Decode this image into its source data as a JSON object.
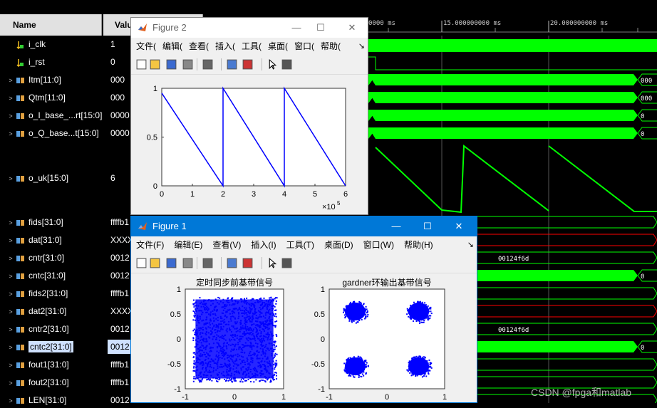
{
  "columns": {
    "name": "Name",
    "value": "Value"
  },
  "signals": [
    {
      "name": "i_clk",
      "value": "1",
      "expand": false,
      "icon": "clock-signal-icon"
    },
    {
      "name": "i_rst",
      "value": "0",
      "expand": false,
      "icon": "reset-signal-icon"
    },
    {
      "name": "Itm[11:0]",
      "value": "000",
      "expand": true,
      "icon": "bus-icon"
    },
    {
      "name": "Qtm[11:0]",
      "value": "000",
      "expand": true,
      "icon": "bus-icon"
    },
    {
      "name": "o_I_base_...rt[15:0]",
      "value": "0000",
      "expand": true,
      "icon": "bus-icon"
    },
    {
      "name": "o_Q_base...t[15:0]",
      "value": "0000",
      "expand": true,
      "icon": "bus-icon"
    },
    {
      "name": "o_uk[15:0]",
      "value": "6",
      "expand": true,
      "icon": "bus-icon"
    },
    {
      "name": "fids[31:0]",
      "value": "ffffb1",
      "expand": true,
      "icon": "bus-icon"
    },
    {
      "name": "dat[31:0]",
      "value": "XXXX",
      "expand": true,
      "icon": "bus-icon"
    },
    {
      "name": "cntr[31:0]",
      "value": "0012",
      "expand": true,
      "icon": "bus-icon"
    },
    {
      "name": "cntc[31:0]",
      "value": "0012",
      "expand": true,
      "icon": "bus-icon"
    },
    {
      "name": "fids2[31:0]",
      "value": "ffffb1",
      "expand": true,
      "icon": "bus-icon"
    },
    {
      "name": "dat2[31:0]",
      "value": "XXXX",
      "expand": true,
      "icon": "bus-icon"
    },
    {
      "name": "cntr2[31:0]",
      "value": "0012",
      "expand": true,
      "icon": "bus-icon"
    },
    {
      "name": "cntc2[31:0]",
      "value": "0012",
      "expand": true,
      "icon": "bus-icon",
      "selected": true
    },
    {
      "name": "fout1[31:0]",
      "value": "ffffb1",
      "expand": true,
      "icon": "bus-icon"
    },
    {
      "name": "fout2[31:0]",
      "value": "ffffb1",
      "expand": true,
      "icon": "bus-icon"
    },
    {
      "name": "LEN[31:0]",
      "value": "0012",
      "expand": true,
      "icon": "bus-icon"
    }
  ],
  "ruler": {
    "labels": [
      "0000 ms",
      "15.000000000 ms",
      "20.000000000 ms"
    ]
  },
  "wave_labels": {
    "itm": "000",
    "qtm": "000",
    "iout": "0",
    "qout": "0",
    "cntr": "00124f6d",
    "cntc": "0",
    "cntr2": "00124f6d",
    "cntc2": "0"
  },
  "colors": {
    "wave": "#00ff00",
    "invalid": "#ff0000",
    "fig_active": "#0078d7",
    "plot": "#0000ff"
  },
  "figure2": {
    "title": "Figure 2",
    "menu": [
      "文件(",
      "编辑(",
      "查看(",
      "插入(",
      "工具(",
      "桌面(",
      "窗口(",
      "帮助("
    ],
    "controls": {
      "min": "—",
      "max": "☐",
      "close": "✕"
    },
    "toolbar_more": "↘",
    "chart_data": {
      "type": "line",
      "xlim": [
        0,
        6
      ],
      "ylim": [
        0,
        1
      ],
      "xticks": [
        "0",
        "1",
        "2",
        "3",
        "4",
        "5",
        "6"
      ],
      "yticks": [
        "0",
        "0.5",
        "1"
      ],
      "xexponent": "×10",
      "xexponent_power": "5",
      "series": [
        {
          "x": [
            0,
            2,
            2,
            4,
            4,
            6
          ],
          "y": [
            0.95,
            0,
            1,
            0,
            1,
            0
          ]
        }
      ]
    }
  },
  "figure1": {
    "title": "Figure 1",
    "menu": [
      "文件(F)",
      "编辑(E)",
      "查看(V)",
      "插入(I)",
      "工具(T)",
      "桌面(D)",
      "窗口(W)",
      "帮助(H)"
    ],
    "controls": {
      "min": "—",
      "max": "☐",
      "close": "✕"
    },
    "toolbar_more": "↘",
    "chart_data": [
      {
        "type": "scatter",
        "title": "定时同步前基带信号",
        "xlim": [
          -1,
          1
        ],
        "ylim": [
          -1,
          1
        ],
        "xticks": [
          "-1",
          "0",
          "1"
        ],
        "yticks": [
          "-1",
          "-0.5",
          "0",
          "0.5",
          "1"
        ],
        "region": {
          "xmin": -0.85,
          "xmax": 0.85,
          "ymin": -0.85,
          "ymax": 0.85
        }
      },
      {
        "type": "scatter",
        "title": "gardner环输出基带信号",
        "xlim": [
          -1,
          1
        ],
        "ylim": [
          -1,
          1
        ],
        "xticks": [
          "-1",
          "0",
          "1"
        ],
        "yticks": [
          "-1",
          "-0.5",
          "0",
          "0.5",
          "1"
        ],
        "clusters": [
          {
            "x": -0.55,
            "y": 0.55
          },
          {
            "x": 0.55,
            "y": 0.55
          },
          {
            "x": -0.55,
            "y": -0.55
          },
          {
            "x": 0.55,
            "y": -0.55
          }
        ]
      }
    ]
  },
  "watermark": "CSDN @fpga和matlab"
}
